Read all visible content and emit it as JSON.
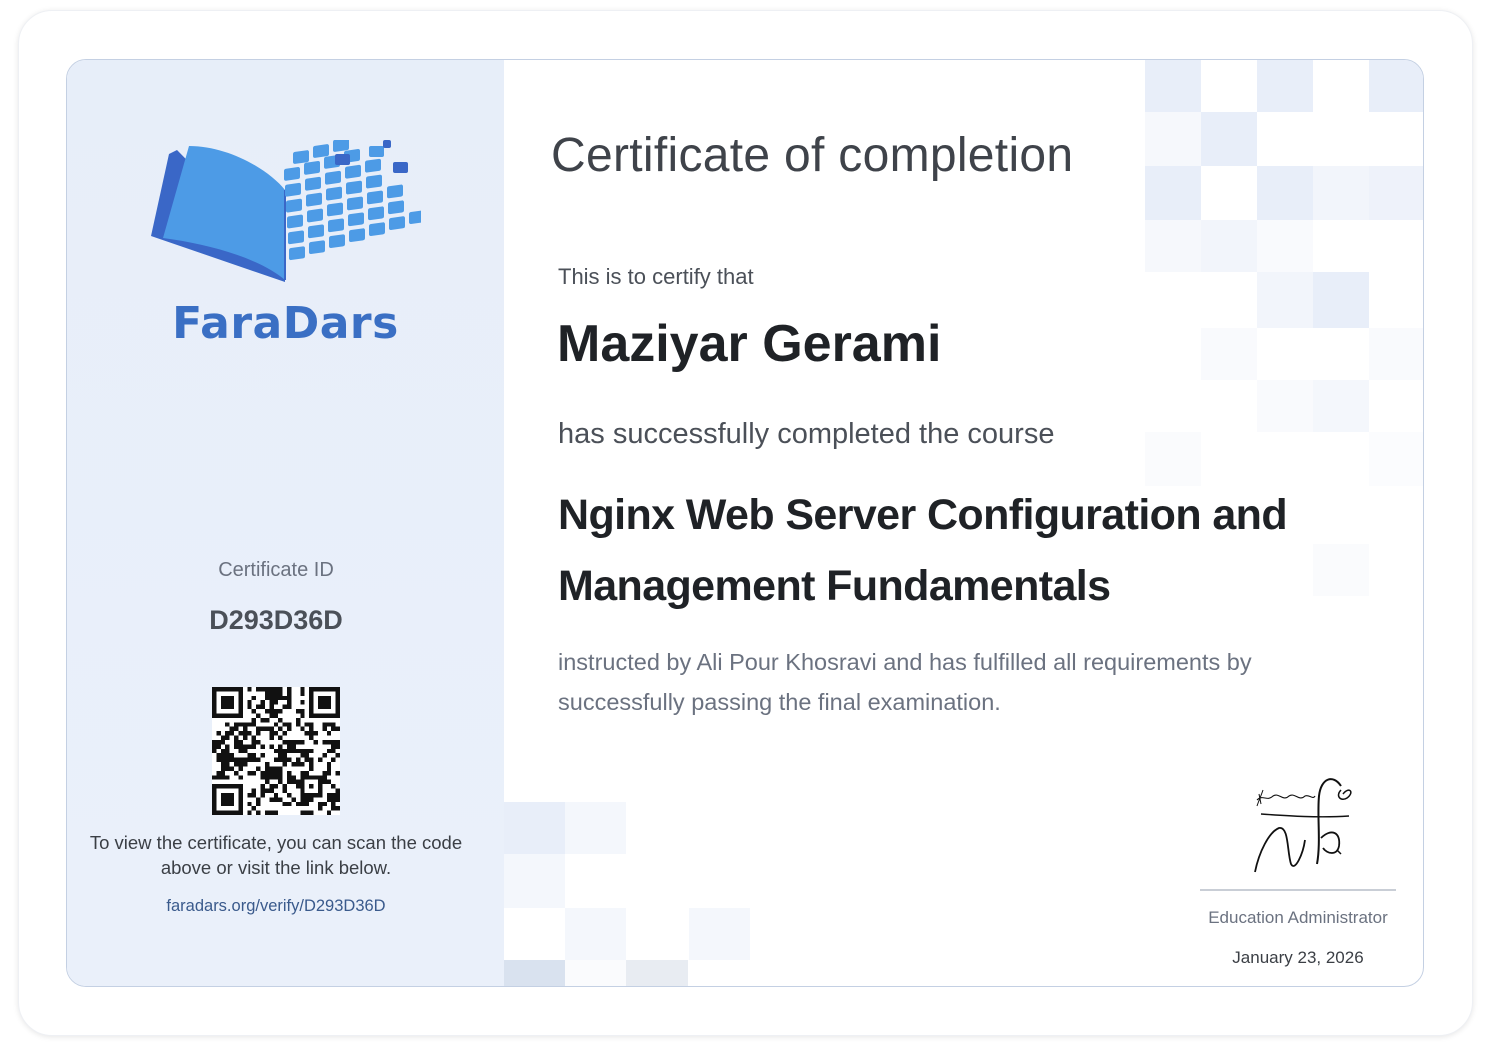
{
  "brand": {
    "name": "FaraDars"
  },
  "certificate": {
    "title": "Certificate of completion",
    "certify_text": "This is to certify that",
    "recipient_name": "Maziyar Gerami",
    "completed_text": "has successfully completed the course",
    "course_name": "Nginx Web Server Configuration and Management Fundamentals",
    "instructed_text": "instructed by Ali Pour Khosravi and has fulfilled all requirements by successfully passing the final examination."
  },
  "certificate_id": {
    "label": "Certificate ID",
    "value": "D293D36D"
  },
  "verification": {
    "scan_text": "To view the certificate, you can scan the code above or visit the link below.",
    "link": "faradars.org/verify/D293D36D"
  },
  "signature": {
    "role": "Education Administrator",
    "date": "January 23, 2026"
  },
  "colors": {
    "brand_blue": "#3a6fc4",
    "book_light": "#4d9be6",
    "book_dark": "#3a67c7",
    "left_panel": "#e9eff9"
  }
}
